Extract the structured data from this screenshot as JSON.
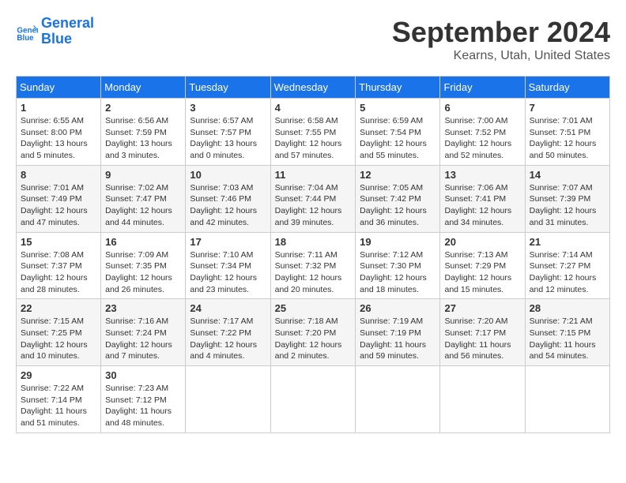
{
  "logo": {
    "line1": "General",
    "line2": "Blue"
  },
  "title": "September 2024",
  "location": "Kearns, Utah, United States",
  "headers": [
    "Sunday",
    "Monday",
    "Tuesday",
    "Wednesday",
    "Thursday",
    "Friday",
    "Saturday"
  ],
  "weeks": [
    [
      {
        "day": "1",
        "info": "Sunrise: 6:55 AM\nSunset: 8:00 PM\nDaylight: 13 hours\nand 5 minutes."
      },
      {
        "day": "2",
        "info": "Sunrise: 6:56 AM\nSunset: 7:59 PM\nDaylight: 13 hours\nand 3 minutes."
      },
      {
        "day": "3",
        "info": "Sunrise: 6:57 AM\nSunset: 7:57 PM\nDaylight: 13 hours\nand 0 minutes."
      },
      {
        "day": "4",
        "info": "Sunrise: 6:58 AM\nSunset: 7:55 PM\nDaylight: 12 hours\nand 57 minutes."
      },
      {
        "day": "5",
        "info": "Sunrise: 6:59 AM\nSunset: 7:54 PM\nDaylight: 12 hours\nand 55 minutes."
      },
      {
        "day": "6",
        "info": "Sunrise: 7:00 AM\nSunset: 7:52 PM\nDaylight: 12 hours\nand 52 minutes."
      },
      {
        "day": "7",
        "info": "Sunrise: 7:01 AM\nSunset: 7:51 PM\nDaylight: 12 hours\nand 50 minutes."
      }
    ],
    [
      {
        "day": "8",
        "info": "Sunrise: 7:01 AM\nSunset: 7:49 PM\nDaylight: 12 hours\nand 47 minutes."
      },
      {
        "day": "9",
        "info": "Sunrise: 7:02 AM\nSunset: 7:47 PM\nDaylight: 12 hours\nand 44 minutes."
      },
      {
        "day": "10",
        "info": "Sunrise: 7:03 AM\nSunset: 7:46 PM\nDaylight: 12 hours\nand 42 minutes."
      },
      {
        "day": "11",
        "info": "Sunrise: 7:04 AM\nSunset: 7:44 PM\nDaylight: 12 hours\nand 39 minutes."
      },
      {
        "day": "12",
        "info": "Sunrise: 7:05 AM\nSunset: 7:42 PM\nDaylight: 12 hours\nand 36 minutes."
      },
      {
        "day": "13",
        "info": "Sunrise: 7:06 AM\nSunset: 7:41 PM\nDaylight: 12 hours\nand 34 minutes."
      },
      {
        "day": "14",
        "info": "Sunrise: 7:07 AM\nSunset: 7:39 PM\nDaylight: 12 hours\nand 31 minutes."
      }
    ],
    [
      {
        "day": "15",
        "info": "Sunrise: 7:08 AM\nSunset: 7:37 PM\nDaylight: 12 hours\nand 28 minutes."
      },
      {
        "day": "16",
        "info": "Sunrise: 7:09 AM\nSunset: 7:35 PM\nDaylight: 12 hours\nand 26 minutes."
      },
      {
        "day": "17",
        "info": "Sunrise: 7:10 AM\nSunset: 7:34 PM\nDaylight: 12 hours\nand 23 minutes."
      },
      {
        "day": "18",
        "info": "Sunrise: 7:11 AM\nSunset: 7:32 PM\nDaylight: 12 hours\nand 20 minutes."
      },
      {
        "day": "19",
        "info": "Sunrise: 7:12 AM\nSunset: 7:30 PM\nDaylight: 12 hours\nand 18 minutes."
      },
      {
        "day": "20",
        "info": "Sunrise: 7:13 AM\nSunset: 7:29 PM\nDaylight: 12 hours\nand 15 minutes."
      },
      {
        "day": "21",
        "info": "Sunrise: 7:14 AM\nSunset: 7:27 PM\nDaylight: 12 hours\nand 12 minutes."
      }
    ],
    [
      {
        "day": "22",
        "info": "Sunrise: 7:15 AM\nSunset: 7:25 PM\nDaylight: 12 hours\nand 10 minutes."
      },
      {
        "day": "23",
        "info": "Sunrise: 7:16 AM\nSunset: 7:24 PM\nDaylight: 12 hours\nand 7 minutes."
      },
      {
        "day": "24",
        "info": "Sunrise: 7:17 AM\nSunset: 7:22 PM\nDaylight: 12 hours\nand 4 minutes."
      },
      {
        "day": "25",
        "info": "Sunrise: 7:18 AM\nSunset: 7:20 PM\nDaylight: 12 hours\nand 2 minutes."
      },
      {
        "day": "26",
        "info": "Sunrise: 7:19 AM\nSunset: 7:19 PM\nDaylight: 11 hours\nand 59 minutes."
      },
      {
        "day": "27",
        "info": "Sunrise: 7:20 AM\nSunset: 7:17 PM\nDaylight: 11 hours\nand 56 minutes."
      },
      {
        "day": "28",
        "info": "Sunrise: 7:21 AM\nSunset: 7:15 PM\nDaylight: 11 hours\nand 54 minutes."
      }
    ],
    [
      {
        "day": "29",
        "info": "Sunrise: 7:22 AM\nSunset: 7:14 PM\nDaylight: 11 hours\nand 51 minutes."
      },
      {
        "day": "30",
        "info": "Sunrise: 7:23 AM\nSunset: 7:12 PM\nDaylight: 11 hours\nand 48 minutes."
      },
      {
        "day": "",
        "info": ""
      },
      {
        "day": "",
        "info": ""
      },
      {
        "day": "",
        "info": ""
      },
      {
        "day": "",
        "info": ""
      },
      {
        "day": "",
        "info": ""
      }
    ]
  ]
}
